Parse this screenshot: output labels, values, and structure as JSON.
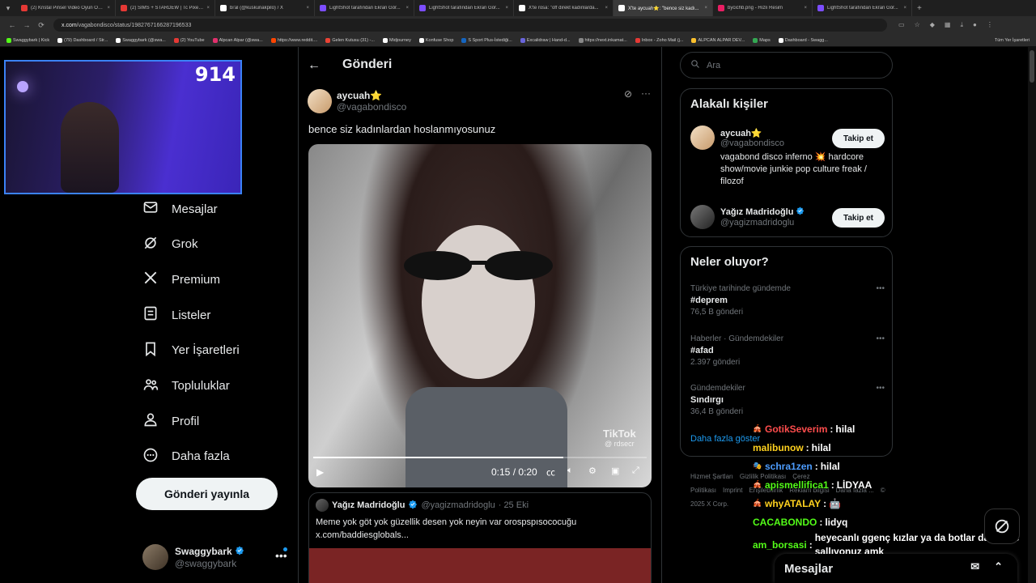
{
  "browser": {
    "tabs": [
      {
        "label": "(2) Kristal Pinsel Video Oyun Oynamak...",
        "color": "#e53935",
        "active": false
      },
      {
        "label": "(2) SIMS + STARDEW | Tc Pixel...",
        "color": "#e53935",
        "active": false
      },
      {
        "label": "bi'al (@kuskunakpilo) / X",
        "color": "#ffffff",
        "active": false
      },
      {
        "label": "LightShot tarafından Ekran Gör...",
        "color": "#7c4dff",
        "active": false
      },
      {
        "label": "LightShot tarafından Ekran Gör...",
        "color": "#7c4dff",
        "active": false
      },
      {
        "label": "X'te rosa: \"off direkt kadınlarda...",
        "color": "#ffffff",
        "active": false
      },
      {
        "label": "X'te aycuah⭐: \"bence siz kadı...",
        "color": "#ffffff",
        "active": true
      },
      {
        "label": "bycichb.png - Hızlı Resim",
        "color": "#e91e63",
        "active": false
      },
      {
        "label": "LightShot tarafından Ekran Gör...",
        "color": "#7c4dff",
        "active": false
      }
    ],
    "url_domain": "x.com",
    "url_path": "/vagabondisco/status/1982767166287196533",
    "bookmarks": [
      {
        "label": "Swaggybark | Kick",
        "color": "#53fc18"
      },
      {
        "label": "(79) Dashboard / Str...",
        "color": "#ffffff"
      },
      {
        "label": "Swaggybark (@swa...",
        "color": "#ffffff"
      },
      {
        "label": "(2) YouTube",
        "color": "#e53935"
      },
      {
        "label": "Alpcan Alpar (@swa...",
        "color": "#e1306c"
      },
      {
        "label": "https://www.reddit....",
        "color": "#ff4500"
      },
      {
        "label": "Gelen Kutusu (31) -...",
        "color": "#ea4335"
      },
      {
        "label": "Midjourney",
        "color": "#ffffff"
      },
      {
        "label": "Konfuse Shop",
        "color": "#ffffff"
      },
      {
        "label": "S Sport Plus-İstediği...",
        "color": "#1565c0"
      },
      {
        "label": "Excalidraw | Hand-d...",
        "color": "#6965db"
      },
      {
        "label": "https://next.inkamat...",
        "color": "#888888"
      },
      {
        "label": "Inbox - Zoho Mail (j...",
        "color": "#e53935"
      },
      {
        "label": "ALPCAN ALPAR DEV...",
        "color": "#fbc02d"
      },
      {
        "label": "Maps",
        "color": "#34a853"
      },
      {
        "label": "Dashboard - Swagg...",
        "color": "#ffffff"
      }
    ],
    "all_bookmarks": "Tüm Yer İşaretleri"
  },
  "webcam": {
    "counter": "914"
  },
  "nav": {
    "items": [
      {
        "label": "Mesajlar",
        "icon": "mail-icon"
      },
      {
        "label": "Grok",
        "icon": "grok-icon"
      },
      {
        "label": "Premium",
        "icon": "x-logo-icon"
      },
      {
        "label": "Listeler",
        "icon": "list-icon"
      },
      {
        "label": "Yer İşaretleri",
        "icon": "bookmark-icon"
      },
      {
        "label": "Topluluklar",
        "icon": "people-icon"
      },
      {
        "label": "Profil",
        "icon": "person-icon"
      },
      {
        "label": "Daha fazla",
        "icon": "more-circle-icon"
      }
    ],
    "post_button": "Gönderi yayınla",
    "account": {
      "name": "Swaggybark",
      "handle": "@swaggybark"
    }
  },
  "post": {
    "header_title": "Gönderi",
    "author_name": "aycuah⭐",
    "author_handle": "@vagabondisco",
    "text": "bence siz kadınlardan hoslanmıyosunuz",
    "video": {
      "time": "0:15 / 0:20",
      "progress": 0.75,
      "watermark": "TikTok",
      "watermark_handle": "@ rdsecr"
    },
    "quote": {
      "name": "Yağız Madridoğlu",
      "handle": "@yagizmadridoglu",
      "date": "· 25 Eki",
      "text": "Meme yok göt yok güzellik desen yok neyin var orospspısococuğu x.com/baddiesglobals..."
    }
  },
  "sidebar": {
    "search_placeholder": "Ara",
    "relevant": {
      "title": "Alakalı kişiler",
      "people": [
        {
          "name": "aycuah⭐",
          "handle": "@vagabondisco",
          "bio": "vagabond disco inferno 💥 hardcore show/movie junkie pop culture freak / filozof",
          "follow": "Takip et"
        },
        {
          "name": "Yağız Madridoğlu",
          "handle": "@yagizmadridoglu",
          "bio": "",
          "follow": "Takip et"
        }
      ]
    },
    "trends": {
      "title": "Neler oluyor?",
      "items": [
        {
          "meta": "Türkiye tarihinde gündemde",
          "tag": "#deprem",
          "count": "76,5 B gönderi"
        },
        {
          "meta": "Haberler · Gündemdekiler",
          "tag": "#afad",
          "count": "2.397 gönderi"
        },
        {
          "meta": "Gündemdekiler",
          "tag": "Sındırgı",
          "count": "36,4 B gönderi"
        }
      ],
      "show_more": "Daha fazla göster"
    },
    "footer": [
      "Hizmet Şartları",
      "Gizlilik Politikası",
      "Çerez Politikası",
      "Imprint",
      "Erişilebilirlik",
      "Reklam bilgisi",
      "Daha fazla ...",
      "© 2025 X Corp."
    ]
  },
  "chat": [
    {
      "user": "GotikSeverim",
      "color": "#ff4d4d",
      "badge": "🎪",
      "msg": "hilal"
    },
    {
      "user": "malibunow",
      "color": "#ffd21f",
      "badge": "",
      "msg": "hilal"
    },
    {
      "user": "schra1zen",
      "color": "#4d9dff",
      "badge": "🎭",
      "msg": "hilal"
    },
    {
      "user": "apismellifica1",
      "color": "#53fc18",
      "badge": "🎪",
      "msg": "LİDYAA"
    },
    {
      "user": "whyATALAY",
      "color": "#ffd21f",
      "badge": "🎪",
      "msg": "🤖"
    },
    {
      "user": "CACABONDO",
      "color": "#53fc18",
      "badge": "",
      "msg": "lidyq"
    },
    {
      "user": "am_borsasi",
      "color": "#53fc18",
      "badge": "",
      "msg": "heyecanlı ggenç kızlar ya da botlar dayı niye sallıyonuz amk"
    }
  ],
  "dm_drawer": {
    "title": "Mesajlar"
  }
}
